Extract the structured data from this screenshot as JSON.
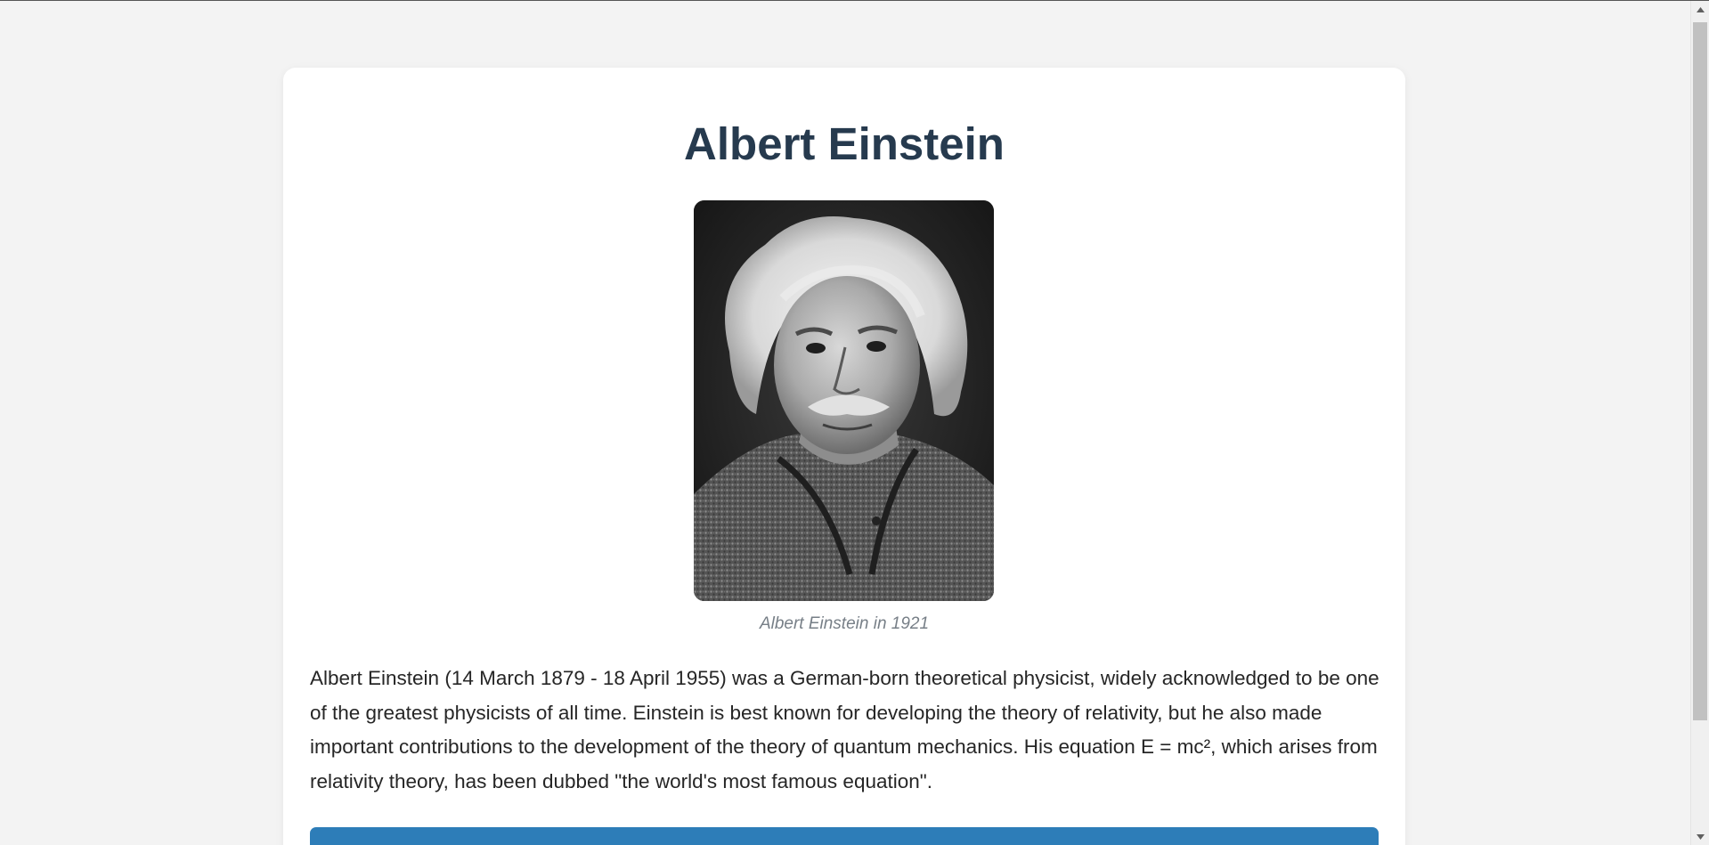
{
  "article": {
    "title": "Albert Einstein",
    "image_caption": "Albert Einstein in 1921",
    "bio": "Albert Einstein (14 March 1879 - 18 April 1955) was a German-born theoretical physicist, widely acknowledged to be one of the greatest physicists of all time. Einstein is best known for developing the theory of relativity, but he also made important contributions to the development of the theory of quantum mechanics. His equation E = mc², which arises from relativity theory, has been dubbed \"the world's most famous equation\"."
  },
  "scrollbar": {
    "position_fraction": 0.0
  },
  "colors": {
    "background": "#f3f3f3",
    "card": "#ffffff",
    "title": "#263a4e",
    "caption": "#777f87",
    "body_text": "#262626",
    "accent": "#2d7db8"
  }
}
